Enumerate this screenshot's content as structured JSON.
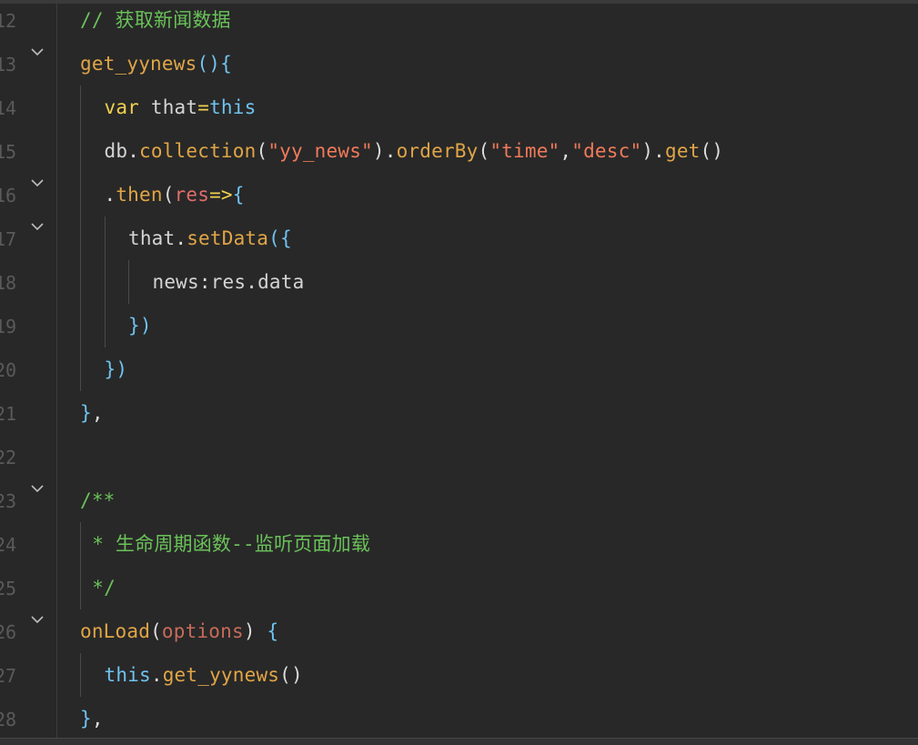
{
  "editor": {
    "lines": [
      {
        "number": "12",
        "fold": false,
        "indent": 0,
        "tokens": [
          {
            "t": "comment",
            "v": "// 获取新闻数据"
          }
        ]
      },
      {
        "number": "13",
        "fold": true,
        "indent": 0,
        "tokens": [
          {
            "t": "func",
            "v": "get_yynews"
          },
          {
            "t": "brace",
            "v": "(){"
          }
        ]
      },
      {
        "number": "14",
        "fold": false,
        "indent": 1,
        "tokens": [
          {
            "t": "kw",
            "v": "var"
          },
          {
            "t": "plain",
            "v": " that"
          },
          {
            "t": "op",
            "v": "="
          },
          {
            "t": "this",
            "v": "this"
          }
        ]
      },
      {
        "number": "15",
        "fold": false,
        "indent": 1,
        "tokens": [
          {
            "t": "plain",
            "v": "db"
          },
          {
            "t": "punc",
            "v": "."
          },
          {
            "t": "method",
            "v": "collection"
          },
          {
            "t": "punc",
            "v": "("
          },
          {
            "t": "str",
            "v": "\"yy_news\""
          },
          {
            "t": "punc",
            "v": ")."
          },
          {
            "t": "method",
            "v": "orderBy"
          },
          {
            "t": "punc",
            "v": "("
          },
          {
            "t": "str",
            "v": "\"time\""
          },
          {
            "t": "punc",
            "v": ","
          },
          {
            "t": "str",
            "v": "\"desc\""
          },
          {
            "t": "punc",
            "v": ")."
          },
          {
            "t": "method",
            "v": "get"
          },
          {
            "t": "punc",
            "v": "()"
          }
        ]
      },
      {
        "number": "16",
        "fold": true,
        "indent": 1,
        "tokens": [
          {
            "t": "punc",
            "v": "."
          },
          {
            "t": "method",
            "v": "then"
          },
          {
            "t": "punc",
            "v": "("
          },
          {
            "t": "param",
            "v": "res"
          },
          {
            "t": "op",
            "v": "=>"
          },
          {
            "t": "brace",
            "v": "{"
          }
        ]
      },
      {
        "number": "17",
        "fold": true,
        "indent": 2,
        "tokens": [
          {
            "t": "plain",
            "v": "that"
          },
          {
            "t": "punc",
            "v": "."
          },
          {
            "t": "method",
            "v": "setData"
          },
          {
            "t": "brace",
            "v": "({"
          }
        ]
      },
      {
        "number": "18",
        "fold": false,
        "indent": 3,
        "tokens": [
          {
            "t": "plain",
            "v": "news"
          },
          {
            "t": "punc",
            "v": ":"
          },
          {
            "t": "plain",
            "v": "res.data"
          }
        ]
      },
      {
        "number": "19",
        "fold": false,
        "indent": 2,
        "tokens": [
          {
            "t": "brace",
            "v": "})"
          }
        ]
      },
      {
        "number": "20",
        "fold": false,
        "indent": 1,
        "tokens": [
          {
            "t": "brace",
            "v": "})"
          }
        ]
      },
      {
        "number": "21",
        "fold": false,
        "indent": 0,
        "tokens": [
          {
            "t": "brace",
            "v": "}"
          },
          {
            "t": "punc",
            "v": ","
          }
        ]
      },
      {
        "number": "22",
        "fold": false,
        "indent": 0,
        "tokens": []
      },
      {
        "number": "23",
        "fold": true,
        "indent": 0,
        "tokens": [
          {
            "t": "comment",
            "v": "/**"
          }
        ]
      },
      {
        "number": "24",
        "fold": false,
        "indent": 0.5,
        "tokens": [
          {
            "t": "comment",
            "v": "* 生命周期函数--监听页面加载"
          }
        ]
      },
      {
        "number": "25",
        "fold": false,
        "indent": 0.5,
        "tokens": [
          {
            "t": "comment",
            "v": "*/"
          }
        ]
      },
      {
        "number": "26",
        "fold": true,
        "indent": 0,
        "tokens": [
          {
            "t": "func",
            "v": "onLoad"
          },
          {
            "t": "punc",
            "v": "("
          },
          {
            "t": "param2",
            "v": "options"
          },
          {
            "t": "punc",
            "v": ")"
          },
          {
            "t": "plain",
            "v": " "
          },
          {
            "t": "brace",
            "v": "{"
          }
        ]
      },
      {
        "number": "27",
        "fold": false,
        "indent": 1,
        "tokens": [
          {
            "t": "this",
            "v": "this"
          },
          {
            "t": "punc",
            "v": "."
          },
          {
            "t": "method",
            "v": "get_yynews"
          },
          {
            "t": "punc",
            "v": "()"
          }
        ]
      },
      {
        "number": "28",
        "fold": false,
        "indent": 0,
        "tokens": [
          {
            "t": "brace",
            "v": "}"
          },
          {
            "t": "punc",
            "v": ","
          }
        ]
      }
    ]
  },
  "colors": {
    "background": "#282828",
    "comment": "#6ac259",
    "function": "#e0a546",
    "keyword": "#f0d050",
    "string": "#f07a5a",
    "brace": "#6fc3f0"
  },
  "icons": {
    "fold": "chevron-down-icon"
  }
}
